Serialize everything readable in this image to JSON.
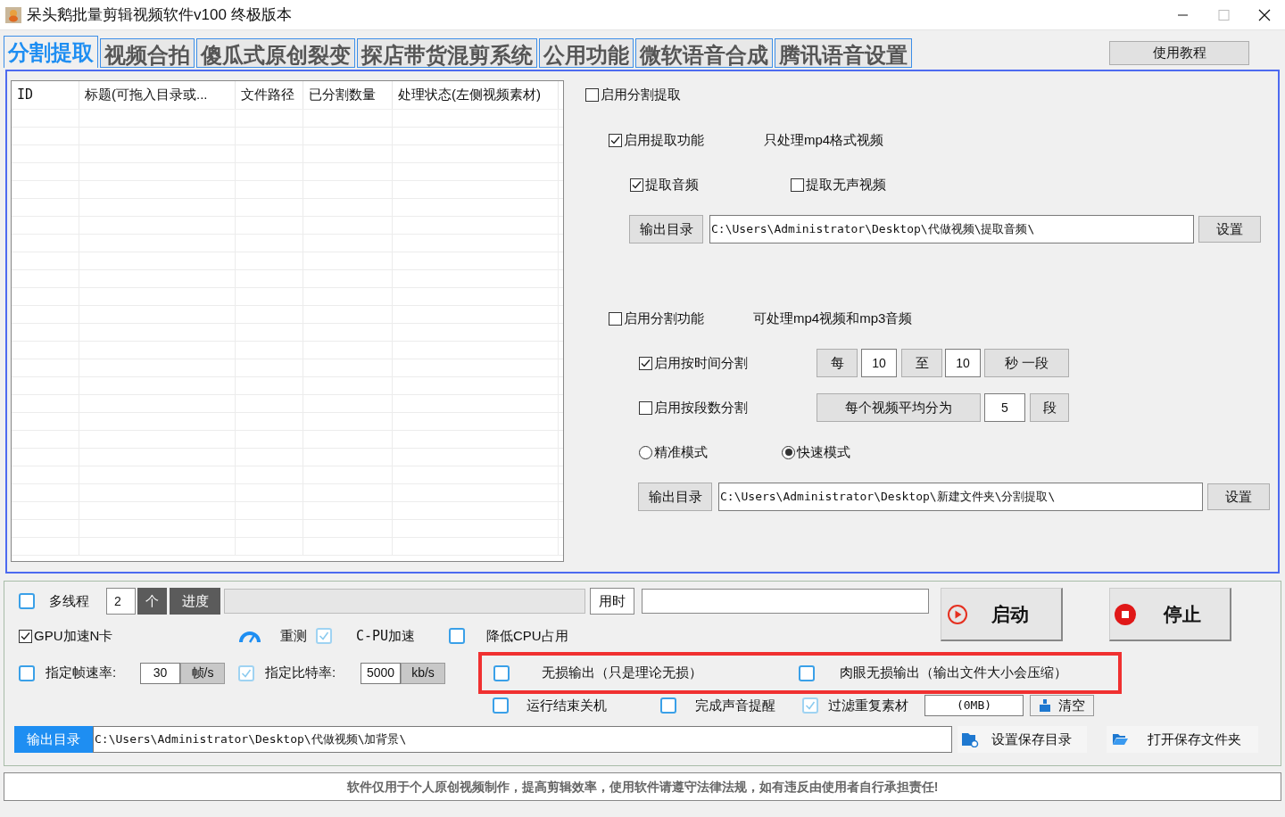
{
  "window": {
    "title": "呆头鹅批量剪辑视频软件v100 终极版本"
  },
  "tabs": [
    {
      "label": "分割提取",
      "selected": true
    },
    {
      "label": "视频合拍",
      "selected": false
    },
    {
      "label": "傻瓜式原创裂变",
      "selected": false
    },
    {
      "label": "探店带货混剪系统",
      "selected": false
    },
    {
      "label": "公用功能",
      "selected": false
    },
    {
      "label": "微软语音合成",
      "selected": false
    },
    {
      "label": "腾讯语音设置",
      "selected": false
    }
  ],
  "help_button": "使用教程",
  "table": {
    "columns": [
      "ID",
      "标题(可拖入目录或...",
      "文件路径",
      "已分割数量",
      "处理状态(左侧视频素材)"
    ]
  },
  "split_extract": {
    "enable": {
      "label": "启用分割提取",
      "checked": false
    },
    "extract": {
      "enable": {
        "label": "启用提取功能",
        "checked": true
      },
      "note": "只处理mp4格式视频",
      "audio": {
        "label": "提取音频",
        "checked": true
      },
      "silent": {
        "label": "提取无声视频",
        "checked": false
      },
      "output_button": "输出目录",
      "output_path": "C:\\Users\\Administrator\\Desktop\\代做视频\\提取音频\\",
      "set_button": "设置"
    },
    "split": {
      "enable": {
        "label": "启用分割功能",
        "checked": false
      },
      "note": "可处理mp4视频和mp3音频",
      "by_time": {
        "label": "启用按时间分割",
        "checked": true,
        "every": "每",
        "from": "10",
        "to_label": "至",
        "to": "10",
        "unit": "秒 一段"
      },
      "by_count": {
        "label": "启用按段数分割",
        "checked": false,
        "prefix": "每个视频平均分为",
        "count": "5",
        "unit": "段"
      },
      "modes": [
        {
          "label": "精准模式",
          "selected": false
        },
        {
          "label": "快速模式",
          "selected": true
        }
      ],
      "output_button": "输出目录",
      "output_path": "C:\\Users\\Administrator\\Desktop\\新建文件夹\\分割提取\\",
      "set_button": "设置"
    }
  },
  "settings": {
    "multithread": {
      "label": "多线程",
      "checked": false,
      "count": "2",
      "unit": "个"
    },
    "progress": {
      "label": "进度",
      "level": 0
    },
    "elapsed": {
      "label": "用时"
    },
    "start_button": "启动",
    "stop_button": "停止",
    "gpu": {
      "label": "GPU加速N卡",
      "checked": true
    },
    "retest_button": "重测",
    "cpu_accel": {
      "label": "C-PU加速",
      "checked": true
    },
    "lower_cpu": {
      "label": "降低CPU占用",
      "checked": false
    },
    "frame_rate": {
      "label": "指定帧速率:",
      "checked": false,
      "value": "30",
      "unit": "帧/s"
    },
    "bitrate": {
      "label": "指定比特率:",
      "checked": true,
      "value": "5000",
      "unit": "kb/s"
    },
    "lossless": {
      "label": "无损输出（只是理论无损）",
      "checked": false
    },
    "visual_lossless": {
      "label": "肉眼无损输出（输出文件大小会压缩）",
      "checked": false
    },
    "shutdown": {
      "label": "运行结束关机",
      "checked": false
    },
    "sound_alert": {
      "label": "完成声音提醒",
      "checked": false
    },
    "filter_duplicates": {
      "label": "过滤重复素材",
      "checked": true,
      "size": "(0MB)",
      "clear_button": "清空"
    },
    "output_label": "输出目录",
    "output_path": "C:\\Users\\Administrator\\Desktop\\代做视频\\加背景\\",
    "set_dir_button": "设置保存目录",
    "open_dir_button": "打开保存文件夹"
  },
  "footer": "软件仅用于个人原创视频制作，提高剪辑效率，使用软件请遵守法律法规，如有违反由使用者自行承担责任!"
}
